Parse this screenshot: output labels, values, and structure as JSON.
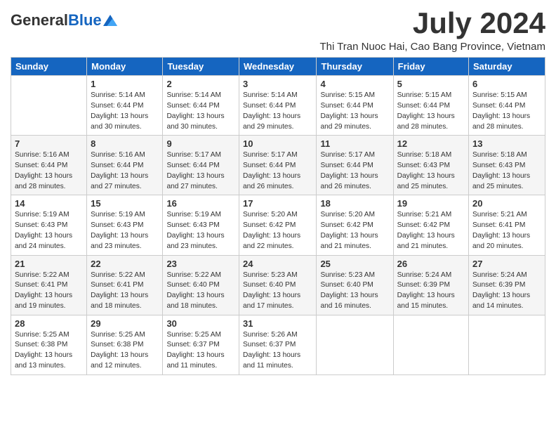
{
  "header": {
    "logo_general": "General",
    "logo_blue": "Blue",
    "title": "July 2024",
    "subtitle": "Thi Tran Nuoc Hai, Cao Bang Province, Vietnam"
  },
  "columns": [
    "Sunday",
    "Monday",
    "Tuesday",
    "Wednesday",
    "Thursday",
    "Friday",
    "Saturday"
  ],
  "weeks": [
    [
      {
        "day": "",
        "content": ""
      },
      {
        "day": "1",
        "content": "Sunrise: 5:14 AM\nSunset: 6:44 PM\nDaylight: 13 hours\nand 30 minutes."
      },
      {
        "day": "2",
        "content": "Sunrise: 5:14 AM\nSunset: 6:44 PM\nDaylight: 13 hours\nand 30 minutes."
      },
      {
        "day": "3",
        "content": "Sunrise: 5:14 AM\nSunset: 6:44 PM\nDaylight: 13 hours\nand 29 minutes."
      },
      {
        "day": "4",
        "content": "Sunrise: 5:15 AM\nSunset: 6:44 PM\nDaylight: 13 hours\nand 29 minutes."
      },
      {
        "day": "5",
        "content": "Sunrise: 5:15 AM\nSunset: 6:44 PM\nDaylight: 13 hours\nand 28 minutes."
      },
      {
        "day": "6",
        "content": "Sunrise: 5:15 AM\nSunset: 6:44 PM\nDaylight: 13 hours\nand 28 minutes."
      }
    ],
    [
      {
        "day": "7",
        "content": "Sunrise: 5:16 AM\nSunset: 6:44 PM\nDaylight: 13 hours\nand 28 minutes."
      },
      {
        "day": "8",
        "content": "Sunrise: 5:16 AM\nSunset: 6:44 PM\nDaylight: 13 hours\nand 27 minutes."
      },
      {
        "day": "9",
        "content": "Sunrise: 5:17 AM\nSunset: 6:44 PM\nDaylight: 13 hours\nand 27 minutes."
      },
      {
        "day": "10",
        "content": "Sunrise: 5:17 AM\nSunset: 6:44 PM\nDaylight: 13 hours\nand 26 minutes."
      },
      {
        "day": "11",
        "content": "Sunrise: 5:17 AM\nSunset: 6:44 PM\nDaylight: 13 hours\nand 26 minutes."
      },
      {
        "day": "12",
        "content": "Sunrise: 5:18 AM\nSunset: 6:43 PM\nDaylight: 13 hours\nand 25 minutes."
      },
      {
        "day": "13",
        "content": "Sunrise: 5:18 AM\nSunset: 6:43 PM\nDaylight: 13 hours\nand 25 minutes."
      }
    ],
    [
      {
        "day": "14",
        "content": "Sunrise: 5:19 AM\nSunset: 6:43 PM\nDaylight: 13 hours\nand 24 minutes."
      },
      {
        "day": "15",
        "content": "Sunrise: 5:19 AM\nSunset: 6:43 PM\nDaylight: 13 hours\nand 23 minutes."
      },
      {
        "day": "16",
        "content": "Sunrise: 5:19 AM\nSunset: 6:43 PM\nDaylight: 13 hours\nand 23 minutes."
      },
      {
        "day": "17",
        "content": "Sunrise: 5:20 AM\nSunset: 6:42 PM\nDaylight: 13 hours\nand 22 minutes."
      },
      {
        "day": "18",
        "content": "Sunrise: 5:20 AM\nSunset: 6:42 PM\nDaylight: 13 hours\nand 21 minutes."
      },
      {
        "day": "19",
        "content": "Sunrise: 5:21 AM\nSunset: 6:42 PM\nDaylight: 13 hours\nand 21 minutes."
      },
      {
        "day": "20",
        "content": "Sunrise: 5:21 AM\nSunset: 6:41 PM\nDaylight: 13 hours\nand 20 minutes."
      }
    ],
    [
      {
        "day": "21",
        "content": "Sunrise: 5:22 AM\nSunset: 6:41 PM\nDaylight: 13 hours\nand 19 minutes."
      },
      {
        "day": "22",
        "content": "Sunrise: 5:22 AM\nSunset: 6:41 PM\nDaylight: 13 hours\nand 18 minutes."
      },
      {
        "day": "23",
        "content": "Sunrise: 5:22 AM\nSunset: 6:40 PM\nDaylight: 13 hours\nand 18 minutes."
      },
      {
        "day": "24",
        "content": "Sunrise: 5:23 AM\nSunset: 6:40 PM\nDaylight: 13 hours\nand 17 minutes."
      },
      {
        "day": "25",
        "content": "Sunrise: 5:23 AM\nSunset: 6:40 PM\nDaylight: 13 hours\nand 16 minutes."
      },
      {
        "day": "26",
        "content": "Sunrise: 5:24 AM\nSunset: 6:39 PM\nDaylight: 13 hours\nand 15 minutes."
      },
      {
        "day": "27",
        "content": "Sunrise: 5:24 AM\nSunset: 6:39 PM\nDaylight: 13 hours\nand 14 minutes."
      }
    ],
    [
      {
        "day": "28",
        "content": "Sunrise: 5:25 AM\nSunset: 6:38 PM\nDaylight: 13 hours\nand 13 minutes."
      },
      {
        "day": "29",
        "content": "Sunrise: 5:25 AM\nSunset: 6:38 PM\nDaylight: 13 hours\nand 12 minutes."
      },
      {
        "day": "30",
        "content": "Sunrise: 5:25 AM\nSunset: 6:37 PM\nDaylight: 13 hours\nand 11 minutes."
      },
      {
        "day": "31",
        "content": "Sunrise: 5:26 AM\nSunset: 6:37 PM\nDaylight: 13 hours\nand 11 minutes."
      },
      {
        "day": "",
        "content": ""
      },
      {
        "day": "",
        "content": ""
      },
      {
        "day": "",
        "content": ""
      }
    ]
  ]
}
